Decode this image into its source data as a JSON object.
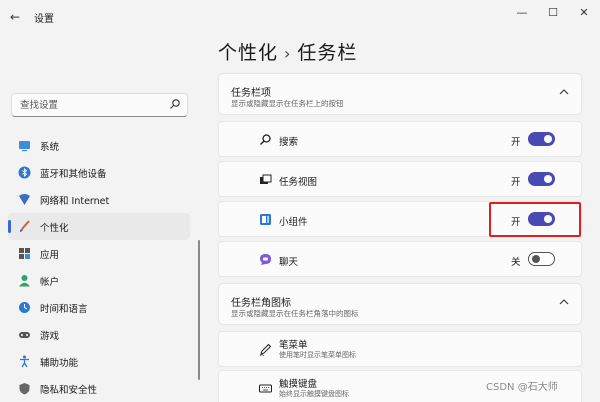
{
  "window": {
    "back_glyph": "←",
    "title": "设置",
    "controls": {
      "minimize": "—",
      "maximize": "☐",
      "close": "✕"
    }
  },
  "search": {
    "placeholder": "查找设置"
  },
  "sidebar": {
    "items": [
      {
        "label": "系统",
        "icon": "monitor-icon",
        "active": false
      },
      {
        "label": "蓝牙和其他设备",
        "icon": "bluetooth-icon",
        "active": false
      },
      {
        "label": "网络和 Internet",
        "icon": "network-icon",
        "active": false
      },
      {
        "label": "个性化",
        "icon": "brush-icon",
        "active": true
      },
      {
        "label": "应用",
        "icon": "apps-icon",
        "active": false
      },
      {
        "label": "帐户",
        "icon": "person-icon",
        "active": false
      },
      {
        "label": "时间和语言",
        "icon": "globe-clock-icon",
        "active": false
      },
      {
        "label": "游戏",
        "icon": "gamepad-icon",
        "active": false
      },
      {
        "label": "辅助功能",
        "icon": "accessibility-icon",
        "active": false
      },
      {
        "label": "隐私和安全性",
        "icon": "shield-icon",
        "active": false
      }
    ]
  },
  "header": {
    "crumb1": "个性化",
    "separator": "›",
    "crumb2": "任务栏"
  },
  "taskbar_items": {
    "title": "任务栏项",
    "subtitle": "显示或隐藏显示在任务栏上的按钮",
    "rows": [
      {
        "label": "搜索",
        "state": "开",
        "on": true,
        "icon": "search-icon"
      },
      {
        "label": "任务视图",
        "state": "开",
        "on": true,
        "icon": "task-view-icon"
      },
      {
        "label": "小组件",
        "state": "开",
        "on": true,
        "icon": "widgets-icon"
      },
      {
        "label": "聊天",
        "state": "关",
        "on": false,
        "icon": "chat-icon"
      }
    ]
  },
  "corner_icons": {
    "title": "任务栏角图标",
    "subtitle": "显示或隐藏显示在任务栏角落中的图标",
    "rows": [
      {
        "label": "笔菜单",
        "sub": "使用笔时显示笔菜单图标",
        "icon": "pen-icon"
      },
      {
        "label": "触摸键盘",
        "sub": "始终显示触摸键盘图标",
        "icon": "keyboard-icon"
      }
    ]
  },
  "watermark": "CSDN @石大师",
  "colors": {
    "accent": "#4a4ab5",
    "highlight": "#e02020",
    "nav_indicator": "#3a66d6"
  }
}
